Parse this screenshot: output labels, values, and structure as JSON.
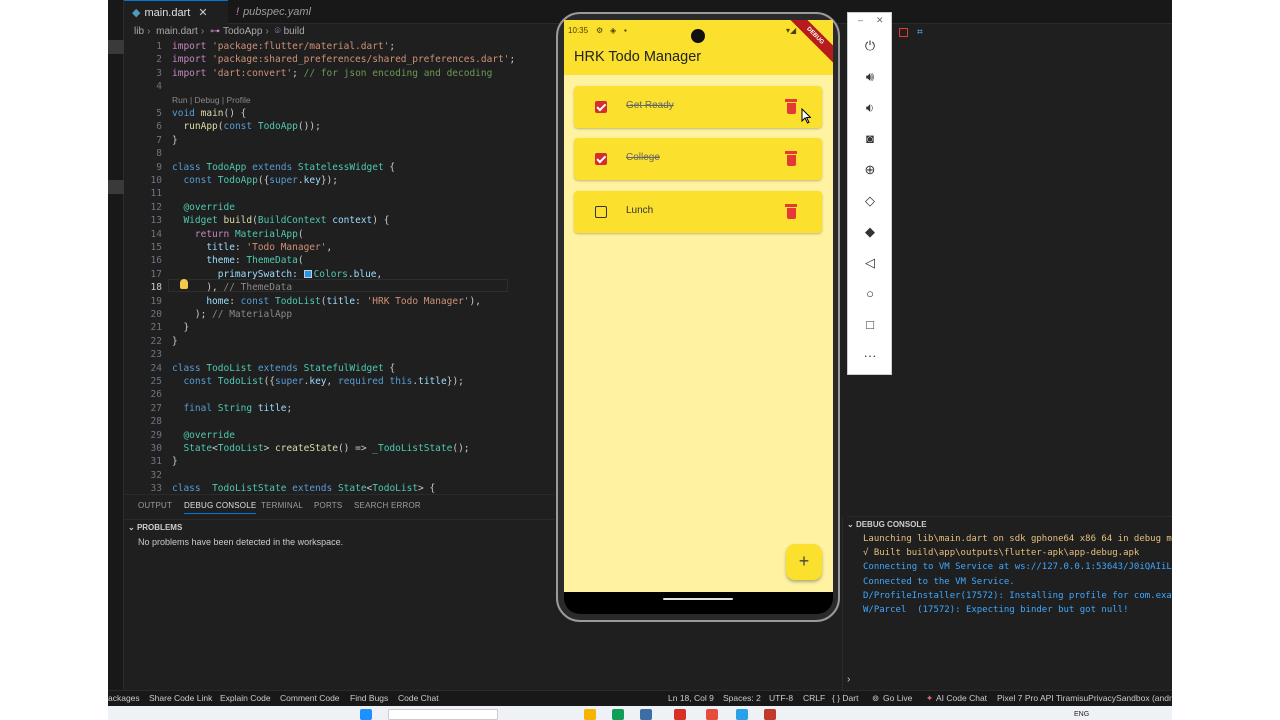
{
  "tabs": [
    {
      "label": "main.dart",
      "icon": "dart-file-icon",
      "active": true
    },
    {
      "label": "pubspec.yaml",
      "icon": "yaml-file-icon",
      "active": false
    }
  ],
  "breadcrumb": [
    "lib",
    "main.dart",
    "TodoApp",
    "build"
  ],
  "code": {
    "lines": [
      {
        "n": "1",
        "html": "<span class=\"kw2\">import</span> <span class=\"str\">'package:flutter/material.dart'</span>;"
      },
      {
        "n": "2",
        "html": "<span class=\"kw2\">import</span> <span class=\"str\">'package:shared_preferences/shared_preferences.dart'</span>;"
      },
      {
        "n": "3",
        "html": "<span class=\"kw2\">import</span> <span class=\"str\">'dart:convert'</span>; <span class=\"cm\">// for json encoding and decoding</span>"
      },
      {
        "n": "4",
        "html": ""
      },
      {
        "n": "",
        "html": "<span class=\"lens\">Run | Debug | Profile</span>"
      },
      {
        "n": "5",
        "html": "<span class=\"kw\">void</span> <span class=\"fn\">main</span>() {"
      },
      {
        "n": "6",
        "html": "  <span class=\"fn\">runApp</span>(<span class=\"kw\">const</span> <span class=\"cls\">TodoApp</span>());"
      },
      {
        "n": "7",
        "html": "}"
      },
      {
        "n": "8",
        "html": ""
      },
      {
        "n": "9",
        "html": "<span class=\"kw\">class</span> <span class=\"cls\">TodoApp</span> <span class=\"kw\">extends</span> <span class=\"cls\">StatelessWidget</span> {"
      },
      {
        "n": "10",
        "html": "  <span class=\"kw\">const</span> <span class=\"cls\">TodoApp</span>({<span class=\"kw\">super</span>.<span class=\"prm\">key</span>});"
      },
      {
        "n": "11",
        "html": ""
      },
      {
        "n": "12",
        "html": "  <span class=\"cls\">@override</span>"
      },
      {
        "n": "13",
        "html": "  <span class=\"cls\">Widget</span> <span class=\"fn\">build</span>(<span class=\"cls\">BuildContext</span> <span class=\"prm\">context</span>) {"
      },
      {
        "n": "14",
        "html": "    <span class=\"kw2\">return</span> <span class=\"cls\">MaterialApp</span>("
      },
      {
        "n": "15",
        "html": "      <span class=\"prm\">title</span>: <span class=\"str\">'Todo Manager'</span>,"
      },
      {
        "n": "16",
        "html": "      <span class=\"prm\">theme</span>: <span class=\"cls\">ThemeData</span>("
      },
      {
        "n": "17",
        "html": "        <span class=\"prm\">primarySwatch</span>: <span class=\"swatch\"></span><span class=\"cls\">Colors</span>.<span class=\"prm\">blue</span>,"
      },
      {
        "n": "18",
        "html": "      ), <span class=\"gray\">// ThemeData</span>"
      },
      {
        "n": "19",
        "html": "      <span class=\"prm\">home</span>: <span class=\"kw\">const</span> <span class=\"cls\">TodoList</span>(<span class=\"prm\">title</span>: <span class=\"str\">'HRK Todo Manager'</span>),"
      },
      {
        "n": "20",
        "html": "    ); <span class=\"gray\">// MaterialApp</span>"
      },
      {
        "n": "21",
        "html": "  }"
      },
      {
        "n": "22",
        "html": "}"
      },
      {
        "n": "23",
        "html": ""
      },
      {
        "n": "24",
        "html": "<span class=\"kw\">class</span> <span class=\"cls\">TodoList</span> <span class=\"kw\">extends</span> <span class=\"cls\">StatefulWidget</span> {"
      },
      {
        "n": "25",
        "html": "  <span class=\"kw\">const</span> <span class=\"cls\">TodoList</span>({<span class=\"kw\">super</span>.<span class=\"prm\">key</span>, <span class=\"kw\">required</span> <span class=\"kw\">this</span>.<span class=\"prm\">title</span>});"
      },
      {
        "n": "26",
        "html": ""
      },
      {
        "n": "27",
        "html": "  <span class=\"kw\">final</span> <span class=\"cls\">String</span> <span class=\"prm\">title</span>;"
      },
      {
        "n": "28",
        "html": ""
      },
      {
        "n": "29",
        "html": "  <span class=\"cls\">@override</span>"
      },
      {
        "n": "30",
        "html": "  <span class=\"cls\">State</span>&lt;<span class=\"cls\">TodoList</span>&gt; <span class=\"fn\">createState</span>() =&gt; <span class=\"cls\">_TodoListState</span>();"
      },
      {
        "n": "31",
        "html": "}"
      },
      {
        "n": "32",
        "html": ""
      },
      {
        "n": "33",
        "html": "<span class=\"kw\">class</span>  <span class=\"cls\">TodoListState</span> <span class=\"kw\">extends</span> <span class=\"cls\">State</span>&lt;<span class=\"cls\">TodoList</span>&gt; {"
      }
    ],
    "current_line": "18"
  },
  "panel": {
    "tabs": [
      "OUTPUT",
      "DEBUG CONSOLE",
      "TERMINAL",
      "PORTS",
      "SEARCH ERROR"
    ],
    "active_tab": "DEBUG CONSOLE",
    "problems_title": "PROBLEMS",
    "problems_message": "No problems have been detected in the workspace."
  },
  "debug_console": {
    "title": "DEBUG CONSOLE",
    "lines": [
      {
        "text": "Launching lib\\main.dart on sdk gphone64 x86 64 in debug m",
        "tone": "dy"
      },
      {
        "text": "√ Built build\\app\\outputs\\flutter-apk\\app-debug.apk",
        "tone": "dy"
      },
      {
        "text": "Connecting to VM Service at ws://127.0.0.1:53643/J0iQAIiL",
        "tone": "db"
      },
      {
        "text": "Connected to the VM Service.",
        "tone": "db"
      },
      {
        "text": "D/ProfileInstaller(17572): Installing profile for com.exa",
        "tone": "db"
      },
      {
        "text": "W/Parcel  (17572): Expecting binder but got null!",
        "tone": "db"
      }
    ]
  },
  "status_bar": {
    "left": [
      "ackages",
      "Share Code Link",
      "Explain Code",
      "Comment Code",
      "Find Bugs",
      "Code Chat"
    ],
    "position": "Ln 18, Col 9",
    "spaces": "Spaces: 2",
    "encoding": "UTF-8",
    "eol": "CRLF",
    "language": "{ } Dart",
    "golive": "Go Live",
    "ai": "AI Code Chat",
    "device": "Pixel 7 Pro API TiramisuPrivacySandbox (androi"
  },
  "taskbar": {
    "lang": "ENG"
  },
  "phone": {
    "time": "10:35",
    "debug_banner": "DEBUG",
    "app_title": "HRK Todo Manager",
    "todos": [
      {
        "label": "Get Ready",
        "done": true
      },
      {
        "label": "College",
        "done": true
      },
      {
        "label": "Lunch",
        "done": false
      }
    ],
    "fab_label": "+"
  },
  "emulator_tools": [
    "power-icon",
    "volume-up-icon",
    "volume-down-icon",
    "camera-icon",
    "zoom-icon",
    "rotate-left-icon",
    "rotate-right-icon",
    "back-icon",
    "home-icon",
    "overview-icon",
    "more-icon"
  ],
  "colors": {
    "accent": "#0078d4",
    "app_yellow": "#fbe12e",
    "app_bg": "#fff3a1",
    "delete_red": "#e53935"
  }
}
